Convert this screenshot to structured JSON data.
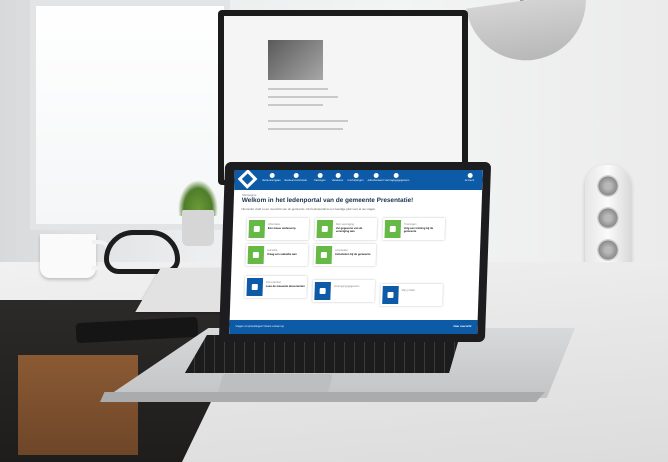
{
  "portal": {
    "nav": [
      {
        "label": "Bestuursorgaan",
        "icon": "info-icon"
      },
      {
        "label": "Bestuurscommissie",
        "icon": "people-icon"
      },
      {
        "label": "Trainingen",
        "icon": "graduation-icon"
      },
      {
        "label": "Vacatures",
        "icon": "document-icon"
      },
      {
        "label": "Inschrijvingen",
        "icon": "chat-icon"
      },
      {
        "label": "Adresbestand",
        "icon": "address-icon"
      },
      {
        "label": "Verenigingsgegevens",
        "icon": "grid-icon"
      }
    ],
    "user_label": "Account",
    "breadcrumb": "Startpagina",
    "title": "Welkom in het ledenportal van de gemeente Presentatie!",
    "intro": "Hieronder vindt u een overzicht van de gemeente. Het ledenportal is een handige plek voor al uw vragen.",
    "tiles": [
      {
        "heading": "Informatie",
        "sub": "Een nieuw onderwerp",
        "icon": "info-icon",
        "color": "green"
      },
      {
        "heading": "Mijn vereniging",
        "sub": "Vul gegevens van de vereniging aan",
        "icon": "document-icon",
        "color": "green"
      },
      {
        "heading": "Trainingen",
        "sub": "Volg een training bij de gemeente",
        "icon": "graduation-icon",
        "color": "green"
      },
      {
        "heading": "Subsidie",
        "sub": "Vraag een subsidie aan",
        "icon": "grid-icon",
        "color": "green"
      },
      {
        "heading": "Activiteiten",
        "sub": "Activiteiten bij de gemeente",
        "icon": "chat-icon",
        "color": "green"
      },
      {
        "heading": "Documenten",
        "sub": "Lees de nieuwste documenten",
        "icon": "document-icon",
        "color": "blue"
      },
      {
        "heading": "Verenigingsgegevens",
        "sub": "",
        "icon": "address-icon",
        "color": "blue"
      },
      {
        "heading": "Mijn profiel",
        "sub": "",
        "icon": "user-icon",
        "color": "blue"
      }
    ],
    "footer_left": "Vragen of opmerkingen? Neem contact op",
    "footer_right": "Naar overzicht"
  }
}
